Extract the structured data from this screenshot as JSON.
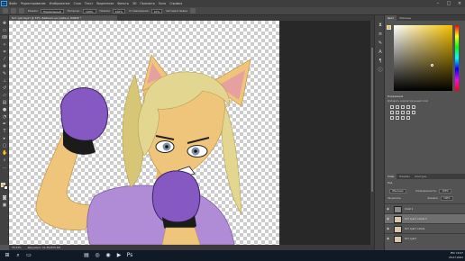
{
  "menu": {
    "app_logo": "Ps",
    "items": [
      "Файл",
      "Редактирование",
      "Изображение",
      "Слои",
      "Текст",
      "Выделение",
      "Фильтр",
      "3D",
      "Просмотр",
      "Окно",
      "Справка"
    ]
  },
  "window_controls": {
    "minimize": "–",
    "maximize": "□",
    "close": "×"
  },
  "options": {
    "mode_label": "Режим:",
    "mode_value": "Нормальный",
    "opacity_label": "Непрозр.:",
    "opacity_value": "100%",
    "flow_label": "Нажим:",
    "flow_value": "100%",
    "smoothing_label": "Сглаживание:",
    "smoothing_value": "10%",
    "symmetry_label": "Авторазгладка"
  },
  "document_tab": {
    "title": "Кот чувствует @ 33% (Кабинет-на-тумбе-1, RGB/8) *"
  },
  "status": {
    "zoom": "33,33%",
    "doc_info": "Документ: 41,3M/355,5M"
  },
  "right_panel": {
    "color_tabs": [
      "Цвет",
      "Образцы"
    ],
    "adjustments_title": "Коррекция",
    "adjustments_sub": "Добавить корректирующий слой",
    "layers_tabs": [
      "Слои",
      "Каналы",
      "Контуры"
    ],
    "kind_label": "Вид",
    "blend_mode": "Обычные",
    "opacity_label": "Непрозрачность:",
    "opacity_value": "100%",
    "lock_label": "Закрепить:",
    "fill_label": "Заливка:",
    "fill_value": "100%",
    "layers": [
      {
        "name": "Слой 1",
        "kind": "layer",
        "selected": false
      },
      {
        "name": "Кот чувст копия 3",
        "kind": "layer",
        "selected": true
      },
      {
        "name": "Кот чувст копия",
        "kind": "layer",
        "selected": false
      },
      {
        "name": "Кот чувст",
        "kind": "layer",
        "selected": false
      }
    ]
  },
  "taskbar": {
    "time": "19:27",
    "date": "25.07.2021",
    "lang": "РУС"
  },
  "colors": {
    "foreground": "#e7c34b",
    "background": "#ffffff",
    "skin": "#efc57c",
    "hair": "#e3d690",
    "glove": "#8659c2",
    "shirt": "#b08bd6"
  }
}
